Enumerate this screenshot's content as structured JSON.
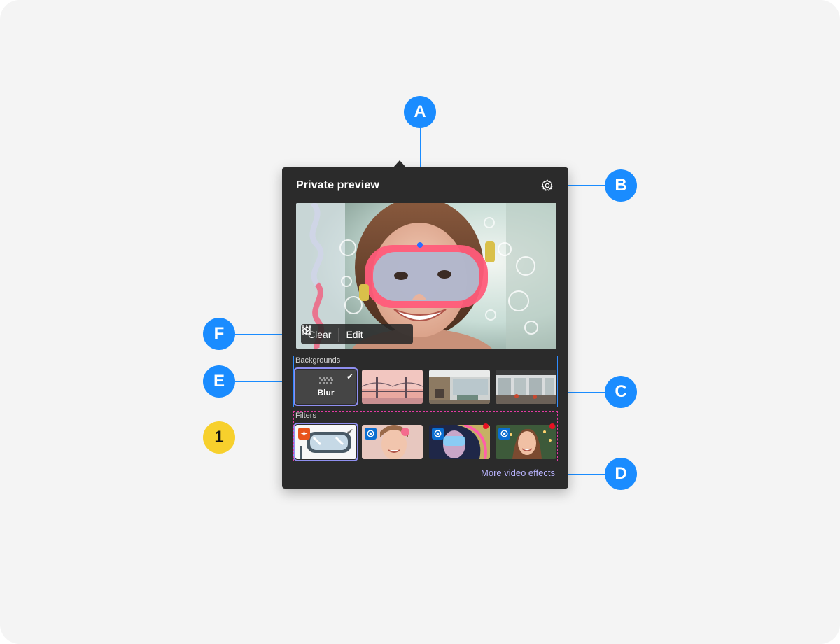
{
  "panel": {
    "title": "Private preview",
    "settings_icon": "gear-icon",
    "preview_actions": {
      "clear_label": "Clear",
      "clear_icon": "eraser-icon",
      "edit_label": "Edit",
      "edit_icon": "sliders-icon"
    },
    "backgrounds": {
      "label": "Backgrounds",
      "items": [
        {
          "label": "Blur",
          "icon": "blur-icon",
          "selected": true
        },
        {
          "label": "",
          "scene": "bridge"
        },
        {
          "label": "",
          "scene": "office-1"
        },
        {
          "label": "",
          "scene": "office-2"
        }
      ]
    },
    "filters": {
      "label": "Filters",
      "items": [
        {
          "scene": "goggles",
          "selected": true,
          "badge_color": "#e8541c"
        },
        {
          "scene": "face-flower",
          "badge_color": "#0a6ed1"
        },
        {
          "scene": "face-rainbow",
          "badge_color": "#0a6ed1",
          "new_dot": true
        },
        {
          "scene": "face-lights",
          "badge_color": "#0a6ed1",
          "new_dot": true
        }
      ]
    },
    "more_link": "More video effects"
  },
  "annotations": {
    "A": "A",
    "B": "B",
    "C": "C",
    "D": "D",
    "E": "E",
    "F": "F",
    "one": "1"
  },
  "colors": {
    "callout_blue": "#1a8cff",
    "callout_yellow": "#f7d02c",
    "leader_pink": "#e53aa2",
    "panel_bg": "#2b2b2b",
    "link": "#b9b4ff"
  }
}
